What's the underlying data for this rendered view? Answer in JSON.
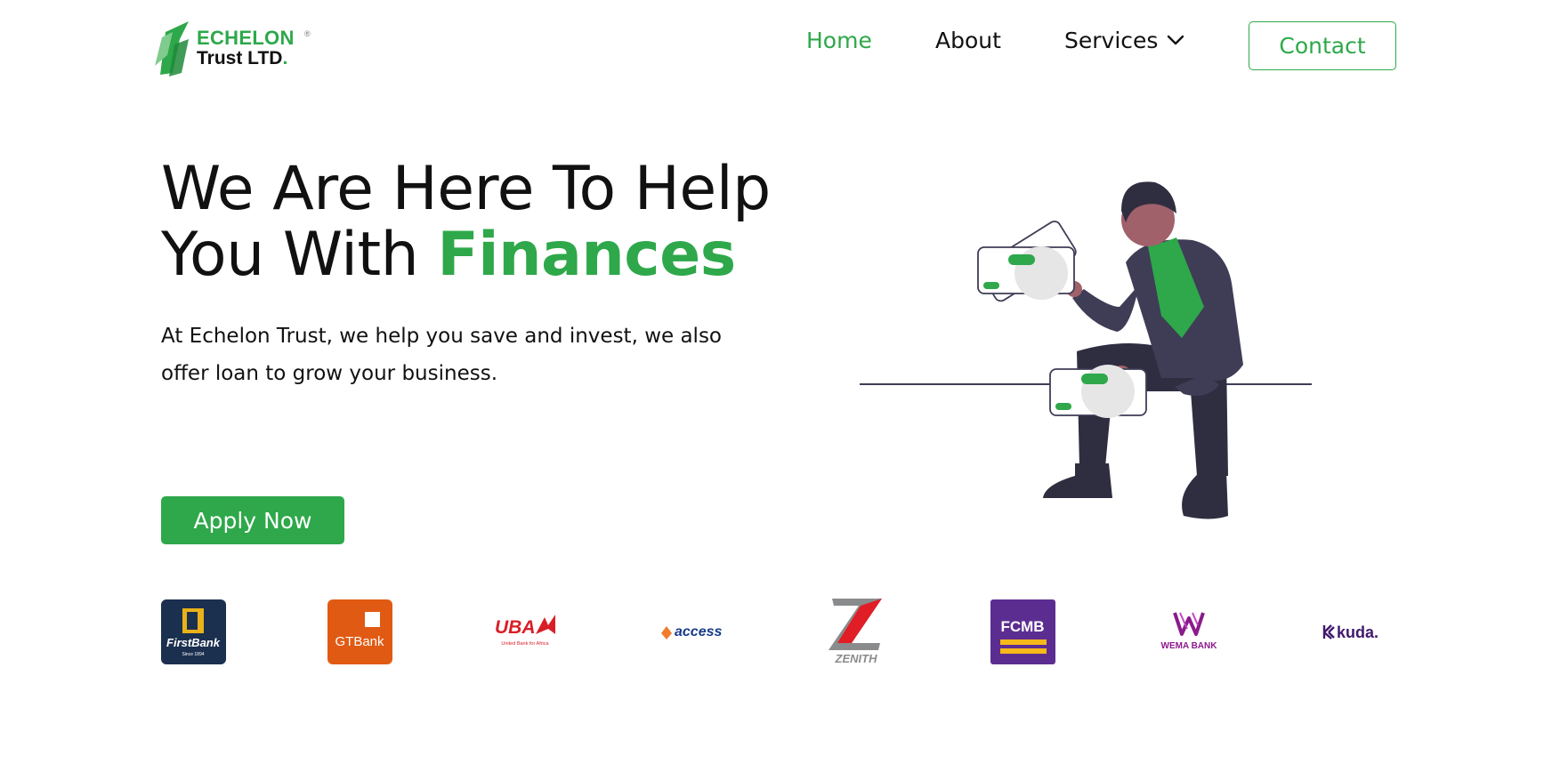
{
  "brand": {
    "name_line1": "ECHELON",
    "registered": "®",
    "name_line2": "Trust LTD",
    "name_line2_dot": ".",
    "green": "#2ea84a"
  },
  "nav": {
    "items": [
      {
        "label": "Home",
        "active": true
      },
      {
        "label": "About",
        "active": false
      },
      {
        "label": "Services",
        "active": false,
        "icon": "chevron-down-icon"
      }
    ],
    "contact_label": "Contact"
  },
  "hero": {
    "title_plain": "We Are Here To Help You With ",
    "title_highlight": "Finances",
    "subtitle": "At Echelon Trust, we help you save and invest, we also offer loan to grow your business.",
    "cta_label": "Apply Now"
  },
  "partners": [
    {
      "name": "FirstBank",
      "tagline": "Since 1894",
      "color": "#1b2f4f"
    },
    {
      "name": "GTBank",
      "color": "#e15a14"
    },
    {
      "name": "UBA",
      "tagline": "United Bank for Africa",
      "color": "#d81f26"
    },
    {
      "name": "access",
      "color": "#173c8b"
    },
    {
      "name": "ZENITH",
      "color": "#e11d25"
    },
    {
      "name": "FCMB",
      "color": "#5c2d91"
    },
    {
      "name": "WEMA BANK",
      "color": "#8b1a8b"
    },
    {
      "name": "kuda.",
      "color": "#40196d"
    }
  ]
}
